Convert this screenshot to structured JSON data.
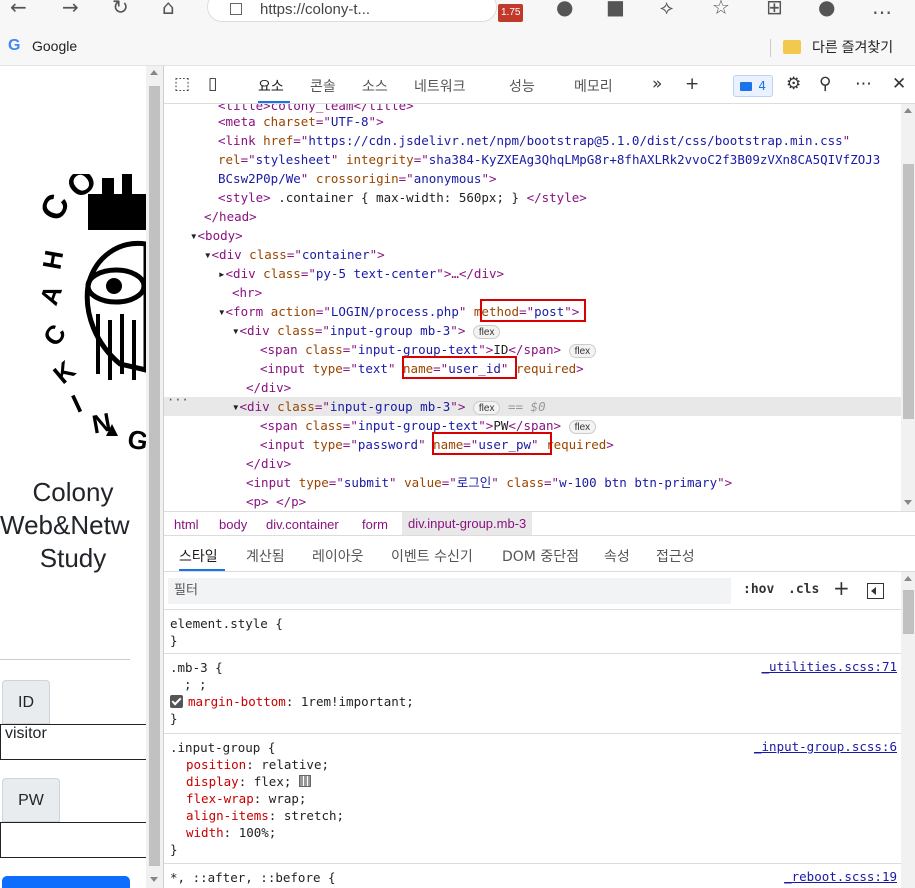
{
  "browser": {
    "url": "https://colony-t...",
    "ext_badge": "1.75",
    "bookmarks": {
      "google": "Google",
      "favorites": "다른 즐겨찾기"
    }
  },
  "page": {
    "title_lines": [
      "Colony",
      "Web&Netw",
      "Study"
    ],
    "id_label": "ID",
    "id_value": "visitor",
    "pw_label": "PW",
    "pw_value": ""
  },
  "devtools": {
    "tabs": [
      "요소",
      "콘솔",
      "소스",
      "네트워크",
      "성능",
      "메모리"
    ],
    "issues_count": "4",
    "code": {
      "meta": [
        "<meta ",
        "charset",
        "=\"",
        "UTF-8",
        "\">"
      ],
      "link1": "https://cdn.jsdelivr.net/npm/bootstrap@5.1.0/dist/css/bootstrap.min.css",
      "link_integrity": "sha384-KyZXEAg3QhqLMpG8r+8fhAXLRk2vvoC2f3B09zVXn8CA5QIVfZOJ3",
      "link_integrity2": "BCsw2P0p/We",
      "crossorigin": "anonymous",
      "style_text": " .container { max-width: 560px; } ",
      "container_class": "container",
      "py5_class": "py-5 text-center",
      "form_action": "LOGIN/process.php",
      "form_method": "post",
      "group_class": "input-group mb-3",
      "span_class": "input-group-text",
      "id_text": "ID",
      "pw_text": "PW",
      "input1_type": "text",
      "input1_name": "user_id",
      "input2_type": "password",
      "input2_name": "user_pw",
      "submit_value": "로그인",
      "submit_class": "w-100 btn btn-primary",
      "flex_pill": "flex",
      "eq": "== $0"
    },
    "breadcrumbs": [
      "html",
      "body",
      "div.container",
      "form",
      "div.input-group.mb-3"
    ],
    "style_tabs": [
      "스타일",
      "계산됨",
      "레이아웃",
      "이벤트 수신기",
      "DOM 중단점",
      "속성",
      "접근성"
    ],
    "filter_placeholder": "필터",
    "hov": ":hov",
    "cls": ".cls",
    "rules": {
      "element_style": "element.style {",
      "mb3_selector": ".mb-3 {",
      "mb3_source": "_utilities.scss:71",
      "mb3_prop": "margin-bottom",
      "mb3_value": "1rem!important;",
      "ig_selector": ".input-group {",
      "ig_source": "_input-group.scss:6",
      "ig_props": [
        [
          "position",
          "relative;"
        ],
        [
          "display",
          "flex;"
        ],
        [
          "flex-wrap",
          "wrap;"
        ],
        [
          "align-items",
          "stretch;"
        ],
        [
          "width",
          "100%;"
        ]
      ],
      "reboot_selector": "*, ::after, ::before {",
      "reboot_source": "_reboot.scss:19"
    }
  }
}
